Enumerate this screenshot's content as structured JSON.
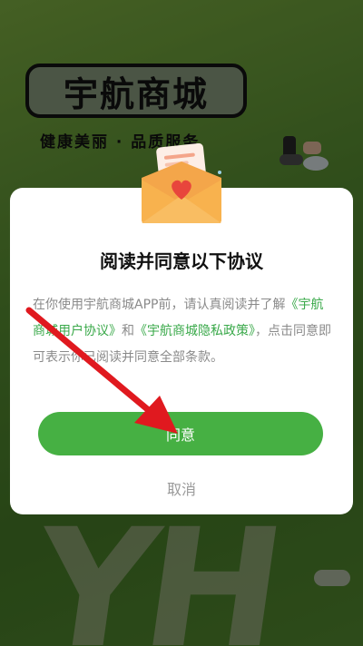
{
  "background": {
    "logo_text": "宇航商城",
    "slogan": "健康美丽 · 品质服务",
    "decor_letters": "YH"
  },
  "dialog": {
    "title": "阅读并同意以下协议",
    "body_prefix": "在你使用宇航商城APP前，请认真阅读并了解",
    "link_user_agreement": "《宇航商城用户协议》",
    "body_and": "和",
    "link_privacy_policy": "《宇航商城隐私政策》",
    "body_suffix": "，点击同意即可表示你已阅读并同意全部条款。",
    "agree_label": "同意",
    "cancel_label": "取消"
  },
  "colors": {
    "primary_green": "#46b043",
    "link_green": "#3aa94a",
    "annotation_red": "#e0191f"
  },
  "icons": [
    "envelope-heart-icon",
    "annotation-arrow-icon"
  ]
}
